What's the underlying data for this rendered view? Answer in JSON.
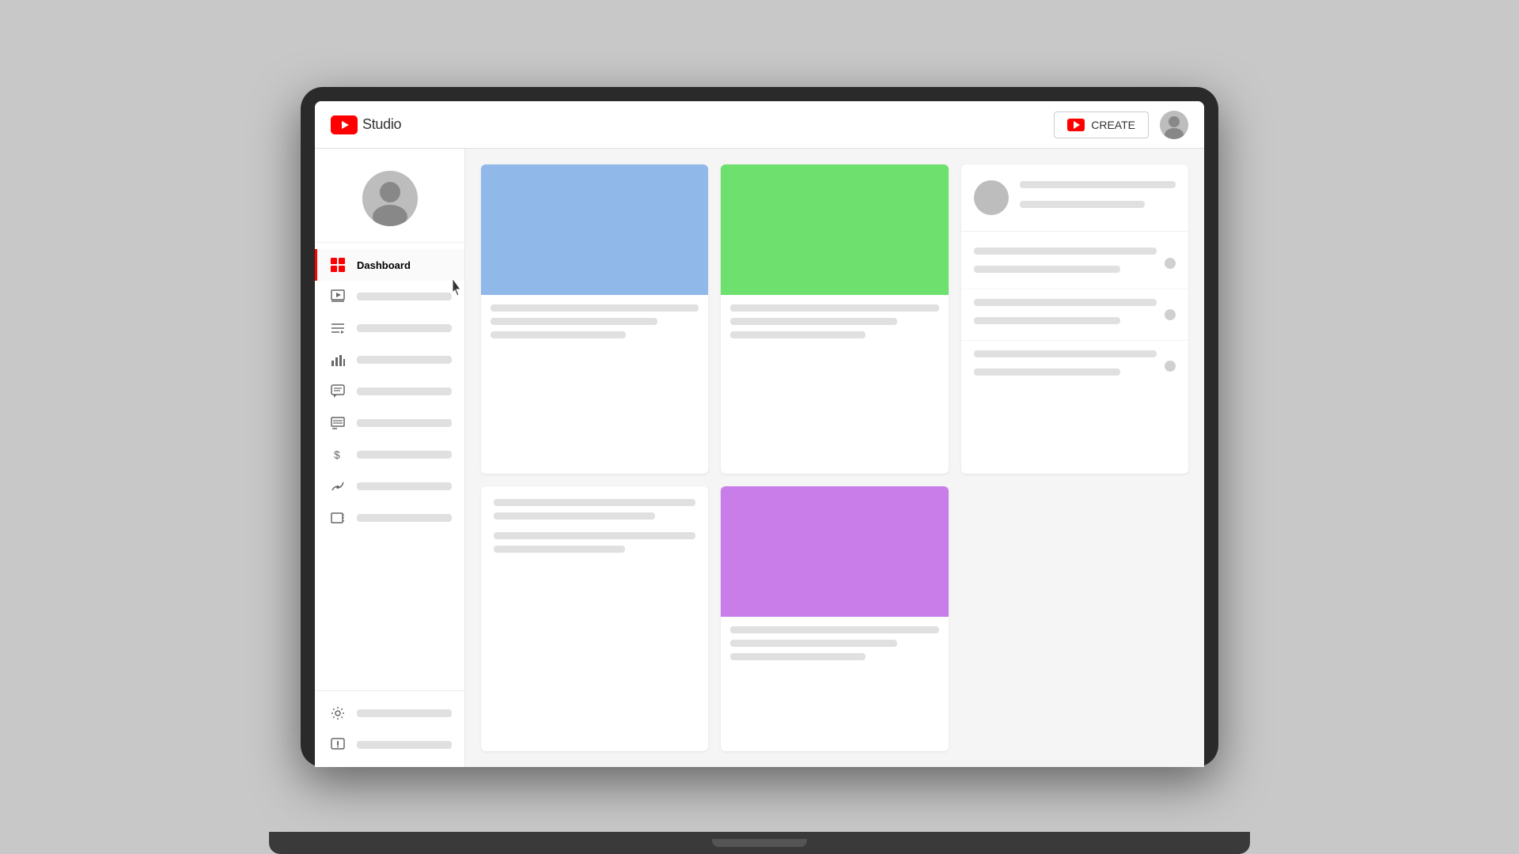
{
  "header": {
    "logo_alt": "YouTube Studio",
    "studio_label": "Studio",
    "create_label": "CREATE",
    "avatar_alt": "User avatar"
  },
  "sidebar": {
    "avatar_alt": "Channel avatar",
    "nav_items": [
      {
        "id": "dashboard",
        "label": "Dashboard",
        "active": true
      },
      {
        "id": "content",
        "label": "Content",
        "active": false
      },
      {
        "id": "playlists",
        "label": "Playlists",
        "active": false
      },
      {
        "id": "analytics",
        "label": "Analytics",
        "active": false
      },
      {
        "id": "comments",
        "label": "Comments",
        "active": false
      },
      {
        "id": "subtitles",
        "label": "Subtitles",
        "active": false
      },
      {
        "id": "monetization",
        "label": "Earn",
        "active": false
      },
      {
        "id": "customization",
        "label": "Customization",
        "active": false
      },
      {
        "id": "audio",
        "label": "Audio Library",
        "active": false
      }
    ],
    "bottom_items": [
      {
        "id": "settings",
        "label": "Settings"
      },
      {
        "id": "feedback",
        "label": "Send Feedback"
      }
    ]
  },
  "main": {
    "cards": [
      {
        "id": "card1",
        "thumbnail_color": "#90b8e8",
        "type": "video"
      },
      {
        "id": "card2",
        "thumbnail_color": "#6ee06e",
        "type": "video"
      },
      {
        "id": "card3",
        "type": "channel"
      },
      {
        "id": "card4",
        "thumbnail_color": "#c87de8",
        "type": "video"
      },
      {
        "id": "card5",
        "type": "text"
      },
      {
        "id": "card6",
        "type": "list"
      }
    ]
  },
  "colors": {
    "youtube_red": "#ff0000",
    "active_border": "#ff0000",
    "skeleton": "#e0e0e0",
    "avatar_bg": "#bdbdbd"
  }
}
